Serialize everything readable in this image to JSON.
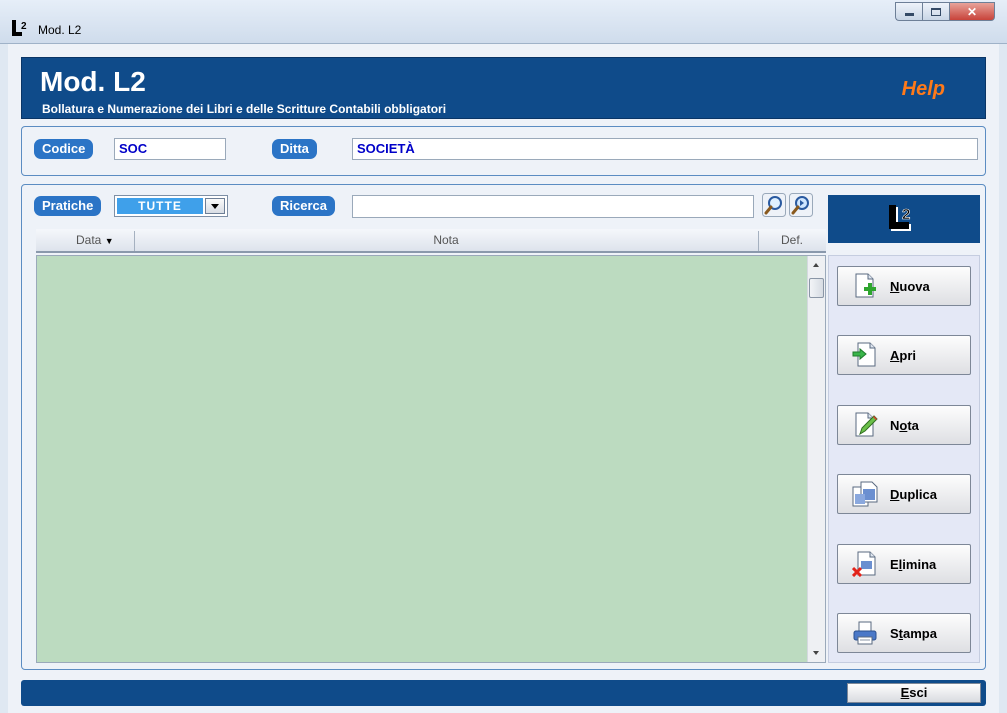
{
  "window": {
    "title": "Mod. L2"
  },
  "header": {
    "title": "Mod. L2",
    "subtitle": "Bollatura e Numerazione dei Libri e delle Scritture Contabili obbligatori",
    "help_label": "Help"
  },
  "company": {
    "codice_label": "Codice",
    "codice_value": "SOC",
    "ditta_label": "Ditta",
    "ditta_value": "SOCIETÀ"
  },
  "filters": {
    "pratiche_label": "Pratiche",
    "pratiche_value": "TUTTE",
    "ricerca_label": "Ricerca",
    "ricerca_value": ""
  },
  "grid": {
    "columns": [
      {
        "key": "data",
        "label": "Data"
      },
      {
        "key": "nota",
        "label": "Nota"
      },
      {
        "key": "def",
        "label": "Def."
      }
    ],
    "rows": []
  },
  "actions": [
    {
      "id": "nuova",
      "hotkey": "N",
      "rest": "uova",
      "icon": "new-document-icon"
    },
    {
      "id": "apri",
      "hotkey": "A",
      "rest": "pri",
      "icon": "open-document-icon"
    },
    {
      "id": "nota",
      "pre": "N",
      "hotkey": "o",
      "rest": "ta",
      "icon": "edit-note-icon"
    },
    {
      "id": "duplica",
      "hotkey": "D",
      "rest": "uplica",
      "icon": "duplicate-icon"
    },
    {
      "id": "elimina",
      "pre": "E",
      "hotkey": "l",
      "rest": "imina",
      "icon": "delete-document-icon"
    },
    {
      "id": "stampa",
      "pre": "S",
      "hotkey": "t",
      "rest": "ampa",
      "icon": "printer-icon"
    }
  ],
  "footer": {
    "esci_hotkey": "E",
    "esci_rest": "sci"
  },
  "colors": {
    "brand_blue": "#0f4b8a",
    "pill_blue": "#2b74c6",
    "help_orange": "#ff7a1a",
    "grid_green": "#bcdbc0"
  }
}
